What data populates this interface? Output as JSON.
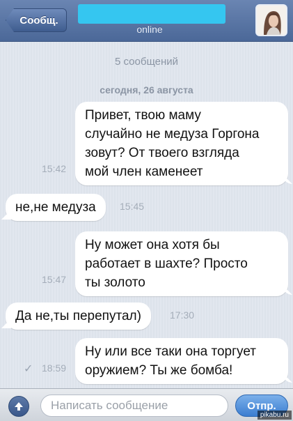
{
  "header": {
    "back_label": "Сообщ.",
    "status": "online"
  },
  "chat": {
    "message_count": "5 сообщений",
    "date": "сегодня, 26 августа",
    "messages": [
      {
        "direction": "out",
        "time": "15:42",
        "lines": [
          "Привет, твою маму",
          "случайно не медуза Горгона",
          "зовут? От твоего взгляда",
          "мой член каменеет"
        ]
      },
      {
        "direction": "in",
        "time": "15:45",
        "lines": [
          "не,не медуза"
        ]
      },
      {
        "direction": "out",
        "time": "15:47",
        "lines": [
          "Ну может она хотя бы",
          "работает в шахте? Просто",
          "ты золото"
        ]
      },
      {
        "direction": "in",
        "time": "17:30",
        "lines": [
          "Да не,ты перепутал)"
        ]
      },
      {
        "direction": "out",
        "time": "18:59",
        "lines": [
          "Ну или все таки она торгует",
          "оружием? Ты же бомба!"
        ],
        "read_check": "✓"
      }
    ]
  },
  "input": {
    "placeholder": "Написать сообщение",
    "send_label": "Отпр."
  },
  "watermark": "pikabu.ru",
  "colors": {
    "header": "#4b6898",
    "name_mask": "#35c6f0",
    "bubble": "#ffffff",
    "send": "#3b7dd0"
  }
}
